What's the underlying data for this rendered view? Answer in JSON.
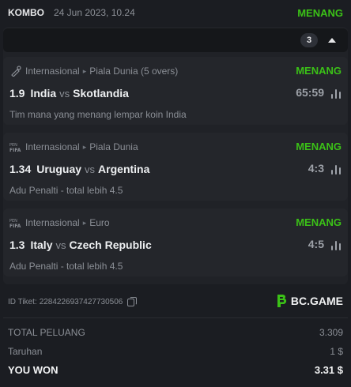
{
  "header": {
    "type_label": "KOMBO",
    "datetime": "24 Jun 2023, 10.24",
    "status": "MENANG"
  },
  "selection_count": "3",
  "matches": [
    {
      "category": "Internasional",
      "tournament": "Piala Dunia (5 overs)",
      "sport_icon": "cricket-icon",
      "status": "MENANG",
      "odds": "1.9",
      "home": "India",
      "vs": "vs",
      "away": "Skotlandia",
      "score": "65:59",
      "market": "Tim mana yang menang lempar koin India"
    },
    {
      "category": "Internasional",
      "tournament": "Piala Dunia",
      "sport_icon": "penalty-fifa-icon",
      "status": "MENANG",
      "odds": "1.34",
      "home": "Uruguay",
      "vs": "vs",
      "away": "Argentina",
      "score": "4:3",
      "market": "Adu Penalti - total lebih 4.5"
    },
    {
      "category": "Internasional",
      "tournament": "Euro",
      "sport_icon": "penalty-fifa-icon",
      "status": "MENANG",
      "odds": "1.3",
      "home": "Italy",
      "vs": "vs",
      "away": "Czech Republic",
      "score": "4:5",
      "market": "Adu Penalti - total lebih 4.5"
    }
  ],
  "ticket": {
    "label": "ID Tiket:",
    "id": "2284226937427730506"
  },
  "brand": {
    "name": "BC.GAME",
    "color": "#3bc117"
  },
  "summary": {
    "total_odds_label": "TOTAL PELUANG",
    "total_odds_value": "3.309",
    "stake_label": "Taruhan",
    "stake_value": "1 $",
    "won_label": "YOU WON",
    "won_value": "3.31 $"
  },
  "colors": {
    "background": "#1b1d22",
    "card": "#24262b",
    "win_green": "#3bc117",
    "muted": "#8b8f96"
  }
}
